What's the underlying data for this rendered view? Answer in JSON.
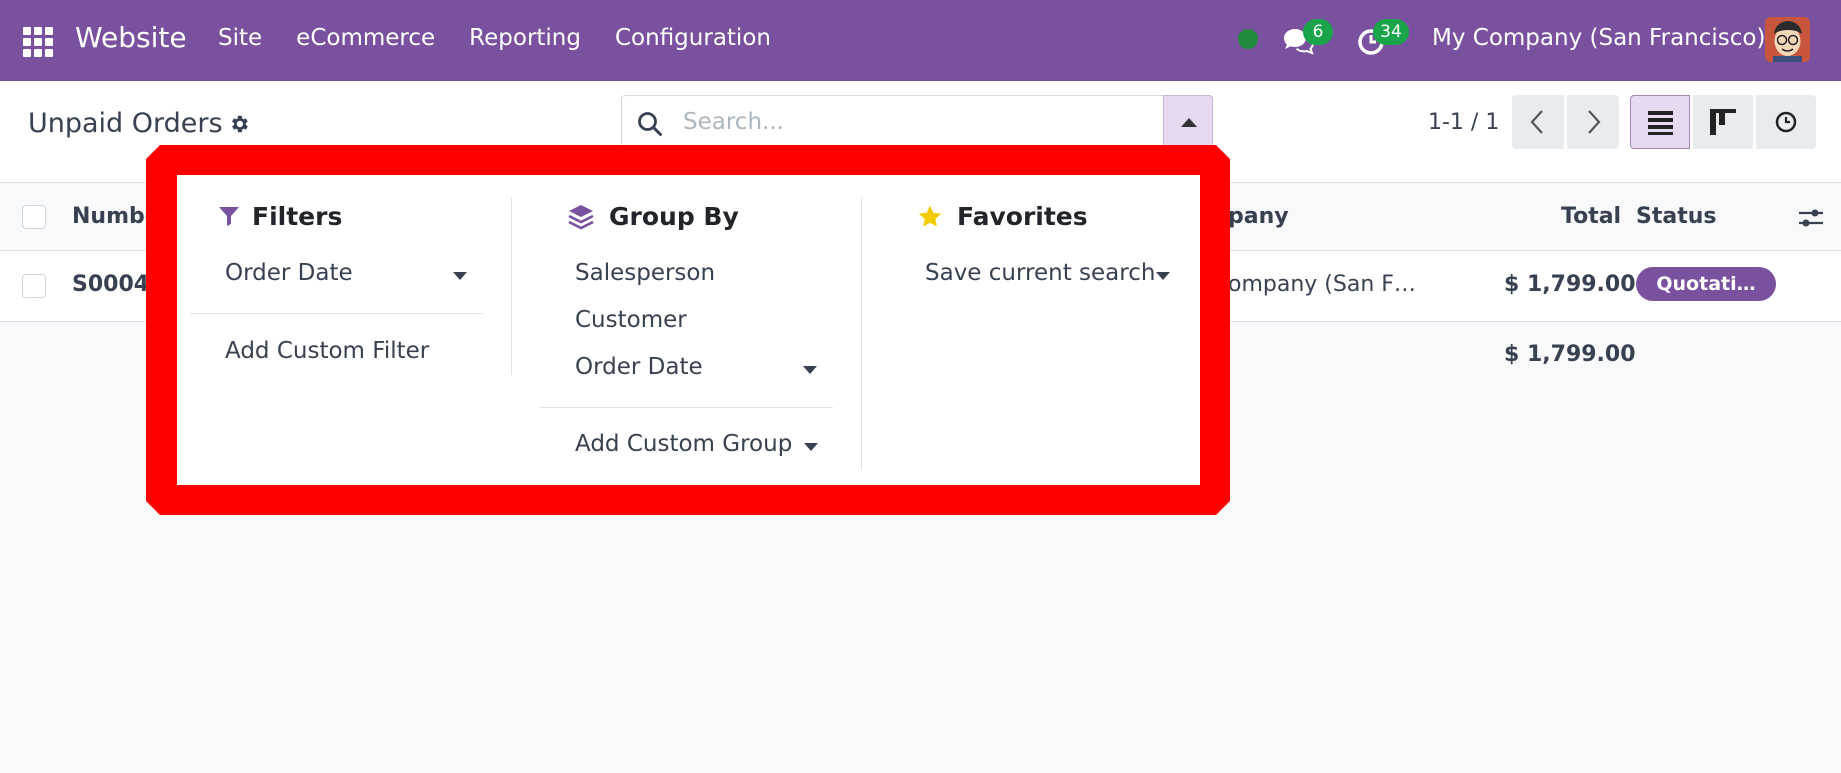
{
  "navbar": {
    "app_name": "Website",
    "menu": [
      "Site",
      "eCommerce",
      "Reporting",
      "Configuration"
    ],
    "chat_count": "6",
    "activity_count": "34",
    "company": "My Company (San Francisco)"
  },
  "control_panel": {
    "title": "Unpaid Orders",
    "search_placeholder": "Search...",
    "pager": "1-1 / 1"
  },
  "list": {
    "headers": {
      "number": "Numbe",
      "company": "pany",
      "total": "Total",
      "status": "Status"
    },
    "rows": [
      {
        "number": "S0004",
        "company": "ompany (San F…",
        "total": "$ 1,799.00",
        "status": "Quotati…"
      }
    ],
    "footer_total": "$ 1,799.00"
  },
  "dropdown": {
    "filters": {
      "title": "Filters",
      "items": [
        "Order Date"
      ],
      "add_custom": "Add Custom Filter"
    },
    "group_by": {
      "title": "Group By",
      "items": [
        "Salesperson",
        "Customer",
        "Order Date"
      ],
      "add_custom": "Add Custom Group"
    },
    "favorites": {
      "title": "Favorites",
      "save_search": "Save current search"
    }
  },
  "colors": {
    "brand": "#7a519e",
    "badge_green": "#1aa54a",
    "highlight": "#ff0000",
    "star": "#f3cc00"
  },
  "icons": [
    "apps-icon",
    "chat-icon",
    "activity-icon",
    "gear-icon",
    "search-icon",
    "filter-icon",
    "layers-icon",
    "star-icon",
    "column-settings-icon"
  ]
}
